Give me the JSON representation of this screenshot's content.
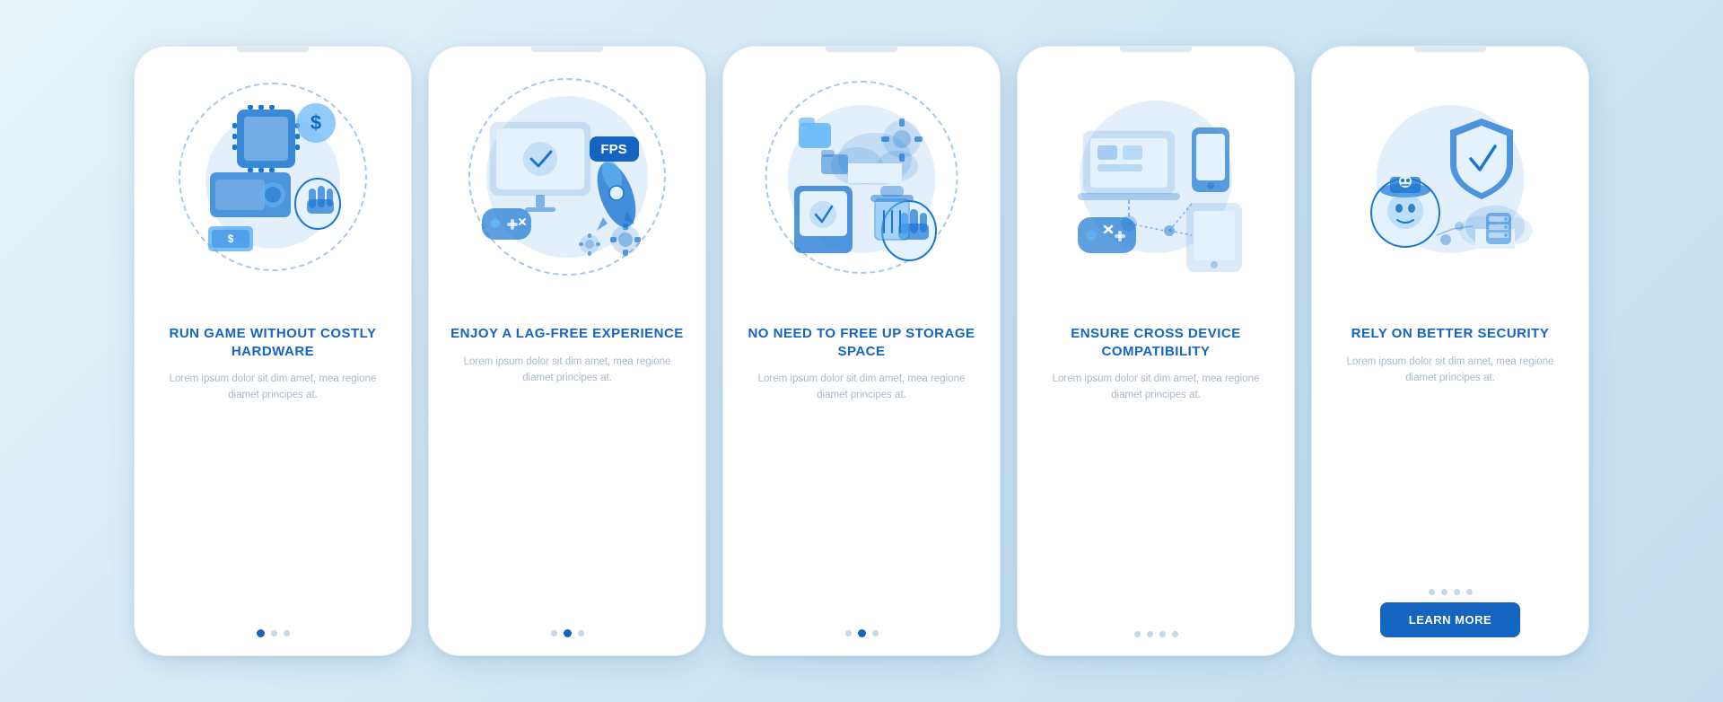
{
  "background": "#d4eaf5",
  "cards": [
    {
      "id": "card-1",
      "title": "RUN GAME WITHOUT COSTLY HARDWARE",
      "body": "Lorem ipsum dolor sit dim amet, mea regione diamet principes at.",
      "dots": [
        true,
        false,
        false
      ],
      "active_dot": 0,
      "show_button": false,
      "button_label": ""
    },
    {
      "id": "card-2",
      "title": "ENJOY A LAG-FREE EXPERIENCE",
      "body": "Lorem ipsum dolor sit dim amet, mea regione diamet principes at.",
      "dots": [
        false,
        true,
        false
      ],
      "active_dot": 1,
      "show_button": false,
      "button_label": ""
    },
    {
      "id": "card-3",
      "title": "NO NEED TO FREE UP STORAGE SPACE",
      "body": "Lorem ipsum dolor sit dim amet, mea regione diamet principes at.",
      "dots": [
        false,
        true,
        false
      ],
      "active_dot": 1,
      "show_button": false,
      "button_label": ""
    },
    {
      "id": "card-4",
      "title": "ENSURE CROSS DEVICE COMPATIBILITY",
      "body": "Lorem ipsum dolor sit dim amet, mea regione diamet principes at.",
      "dots": [
        false,
        false,
        false
      ],
      "active_dot": -1,
      "show_button": false,
      "button_label": ""
    },
    {
      "id": "card-5",
      "title": "RELY ON BETTER SECURITY",
      "body": "Lorem ipsum dolor sit dim amet, mea regione diamet principes at.",
      "dots": [
        false,
        false,
        false
      ],
      "active_dot": -1,
      "show_button": true,
      "button_label": "LEARN MORE"
    }
  ]
}
